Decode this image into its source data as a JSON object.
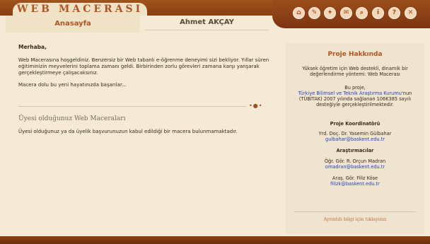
{
  "header": {
    "brand": "WEB MACERASI",
    "home_tab": "Anasayfa",
    "user_name": "Ahmet AKÇAY",
    "icons": [
      "home-icon",
      "edit-icon",
      "tools-icon",
      "mail-icon",
      "search-icon",
      "info-icon",
      "help-icon",
      "close-icon"
    ]
  },
  "main": {
    "greeting": "Merhaba,",
    "intro": "Web Macerasına hoşgeldiniz. Benzersiz bir Web tabanlı e-öğrenme deneyimi sizi bekliyor. Yıllar süren eğitiminizin meyvelerini toplama zamanı geldi. Birbirinden zorlu görevleri zamana karşı yanşarak gerçekleştirmeye çalışacaksınız.",
    "wish": "Macera dolu bu yeni hayatınızda başarılar...",
    "section_title": "Üyesi olduğunuz Web Maceraları",
    "section_text": "Üyesi olduğunuz ya da üyelik başvurunuzun kabul edildiği bir macera bulunmamaktadır."
  },
  "sidebar": {
    "title": "Proje Hakkında",
    "about": "Yüksek öğretim için Web destekli, dinamik bir değerlendirme yöntemi: Web Macerası",
    "project_prefix": "Bu proje,",
    "project_link": "Türkiye Bilimsel ve Teknik Araştırma Kurumu",
    "project_suffix": "'nun (TÜBİTAK) 2007 yılında sağlanan 106K385 sayılı desteğiyle gerçekleştirilmektedir.",
    "coordinator_heading": "Proje Koordinatörü",
    "coordinator_name": "Yrd. Doç. Dr. Yasemin Gülbahar",
    "coordinator_email": "gulbahar@baskent.edu.tr",
    "researchers_heading": "Araştırmacılar",
    "researcher1_name": "Öğr. Gör. R. Orçun Madran",
    "researcher1_email": "omadran@baskent.edu.tr",
    "researcher2_name": "Araş. Gör. Filiz Köse",
    "researcher2_email": "filizk@baskent.edu.tr",
    "more_info": "Ayrıntılı bilgi için tıklayınız"
  }
}
